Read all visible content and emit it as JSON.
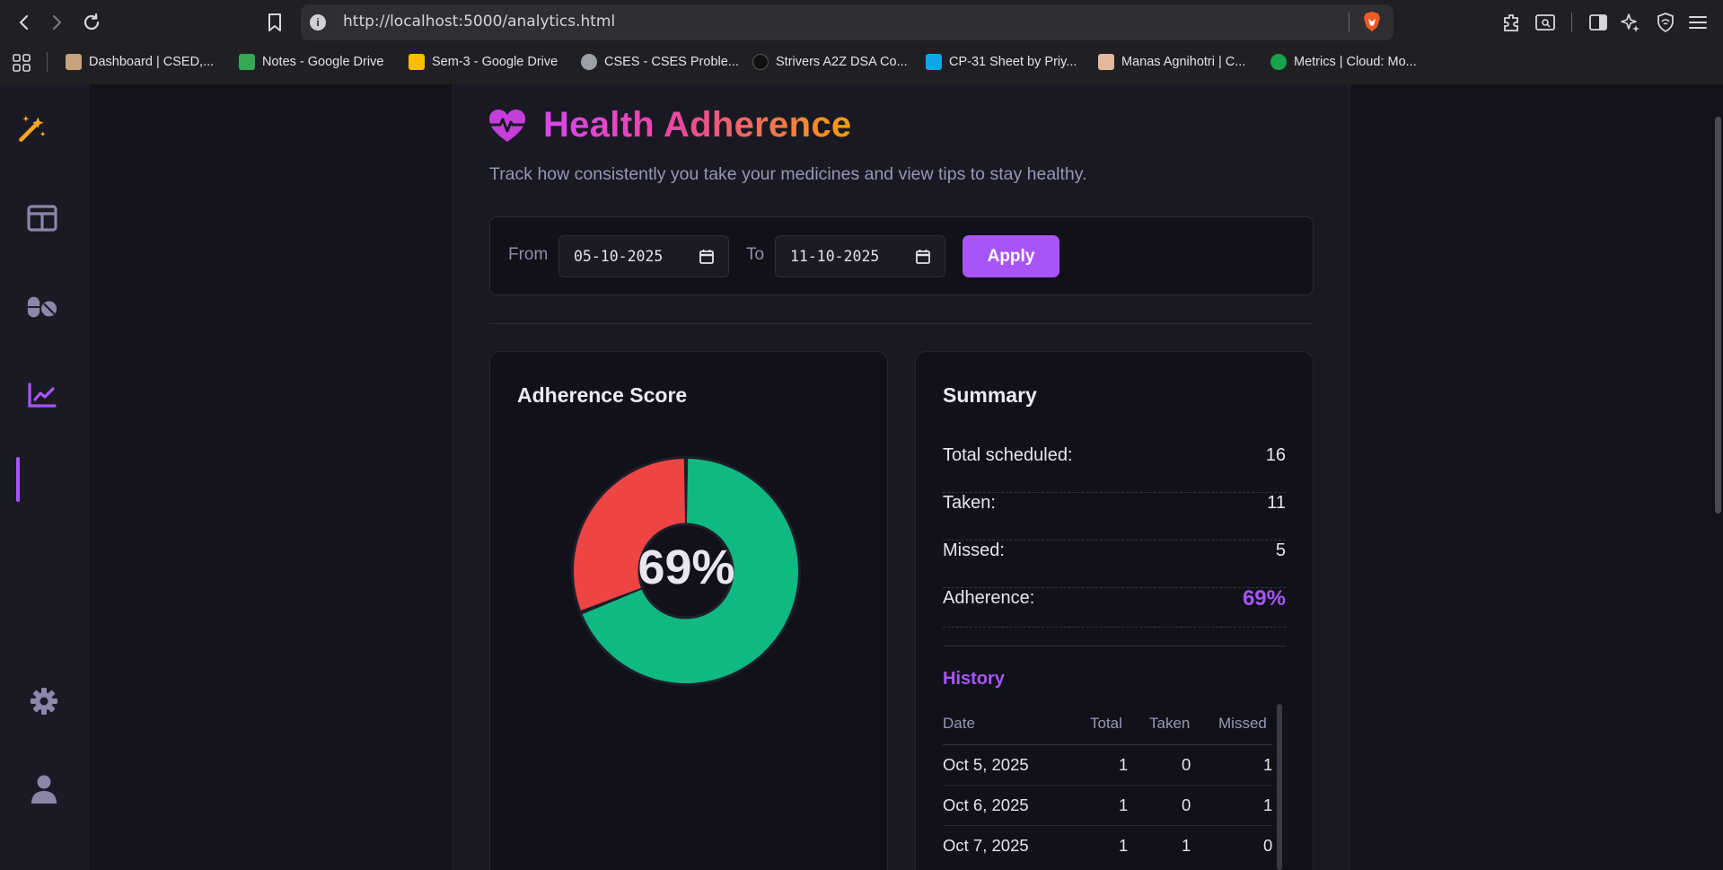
{
  "browser": {
    "url": "http://localhost:5000/analytics.html",
    "bookmarks": [
      {
        "label": "Dashboard | CSED,...",
        "color": "#c8a27a"
      },
      {
        "label": "Notes - Google Drive",
        "color": "#34a853"
      },
      {
        "label": "Sem-3 - Google Drive",
        "color": "#fbbc04"
      },
      {
        "label": "CSES - CSES Proble...",
        "color": "#9aa0a6"
      },
      {
        "label": "Strivers A2Z DSA Co...",
        "color": "#111111"
      },
      {
        "label": "CP-31 Sheet by Priy...",
        "color": "#0ea5e9"
      },
      {
        "label": "Manas Agnihotri | C...",
        "color": "#e2b79b"
      },
      {
        "label": "Metrics | Cloud: Mo...",
        "color": "#16a34a"
      }
    ]
  },
  "page": {
    "title": "Health Adherence",
    "subtitle": "Track how consistently you take your medicines and view tips to stay healthy."
  },
  "filter": {
    "from_label": "From",
    "from_value": "05-10-2025",
    "to_label": "To",
    "to_value": "11-10-2025",
    "apply_label": "Apply"
  },
  "score": {
    "title": "Adherence Score",
    "value_text": "69%",
    "fraction": 0.69,
    "taken_color": "#10b981",
    "missed_color": "#ef4444"
  },
  "summary": {
    "title": "Summary",
    "rows": [
      {
        "label": "Total scheduled:",
        "value": "16"
      },
      {
        "label": "Taken:",
        "value": "11"
      },
      {
        "label": "Missed:",
        "value": "5"
      },
      {
        "label": "Adherence:",
        "value": "69%"
      }
    ],
    "accent_color": "#a855f7"
  },
  "history": {
    "title": "History",
    "columns": [
      "Date",
      "Total",
      "Taken",
      "Missed"
    ],
    "rows": [
      [
        "Oct 5, 2025",
        "1",
        "0",
        "1"
      ],
      [
        "Oct 6, 2025",
        "1",
        "0",
        "1"
      ],
      [
        "Oct 7, 2025",
        "1",
        "1",
        "0"
      ]
    ]
  },
  "sidebar": {
    "items": [
      {
        "icon": "magic-wand-icon"
      },
      {
        "icon": "layout-icon"
      },
      {
        "icon": "pills-icon"
      },
      {
        "icon": "chart-line-icon",
        "active": true
      },
      {
        "icon": "gear-icon"
      },
      {
        "icon": "user-icon"
      }
    ]
  }
}
